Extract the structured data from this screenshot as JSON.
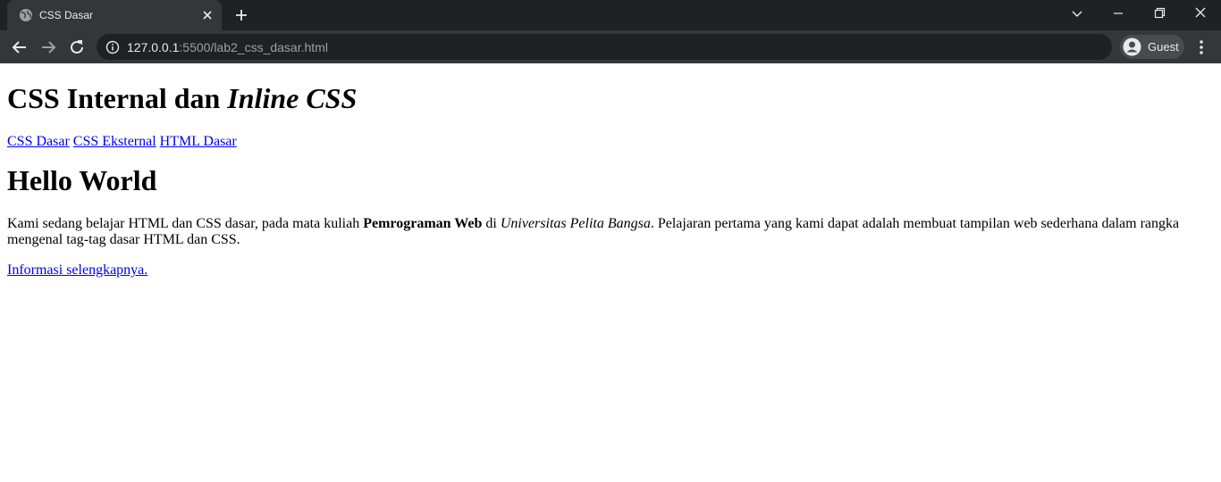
{
  "browser": {
    "tab": {
      "title": "CSS Dasar",
      "favicon": "globe-icon"
    },
    "address": {
      "host": "127.0.0.1",
      "rest": ":5500/lab2_css_dasar.html"
    },
    "profile": {
      "label": "Guest"
    }
  },
  "page": {
    "title_plain": "CSS Internal dan ",
    "title_italic": "Inline CSS",
    "nav_links": [
      "CSS Dasar",
      "CSS Eksternal",
      "HTML Dasar"
    ],
    "heading": "Hello World",
    "paragraph": {
      "part1": "Kami sedang belajar HTML dan CSS dasar, pada mata kuliah ",
      "bold": "Pemrograman Web",
      "part2": " di ",
      "italic": "Universitas Pelita Bangsa",
      "part3": ". Pelajaran pertama yang kami dapat adalah membuat tampilan web sederhana dalam rangka mengenal tag-tag dasar HTML dan CSS."
    },
    "more_link": "Informasi selengkapnya."
  },
  "colors": {
    "chrome_dark": "#202124",
    "chrome_toolbar": "#35363a",
    "link": "#0000ee"
  }
}
